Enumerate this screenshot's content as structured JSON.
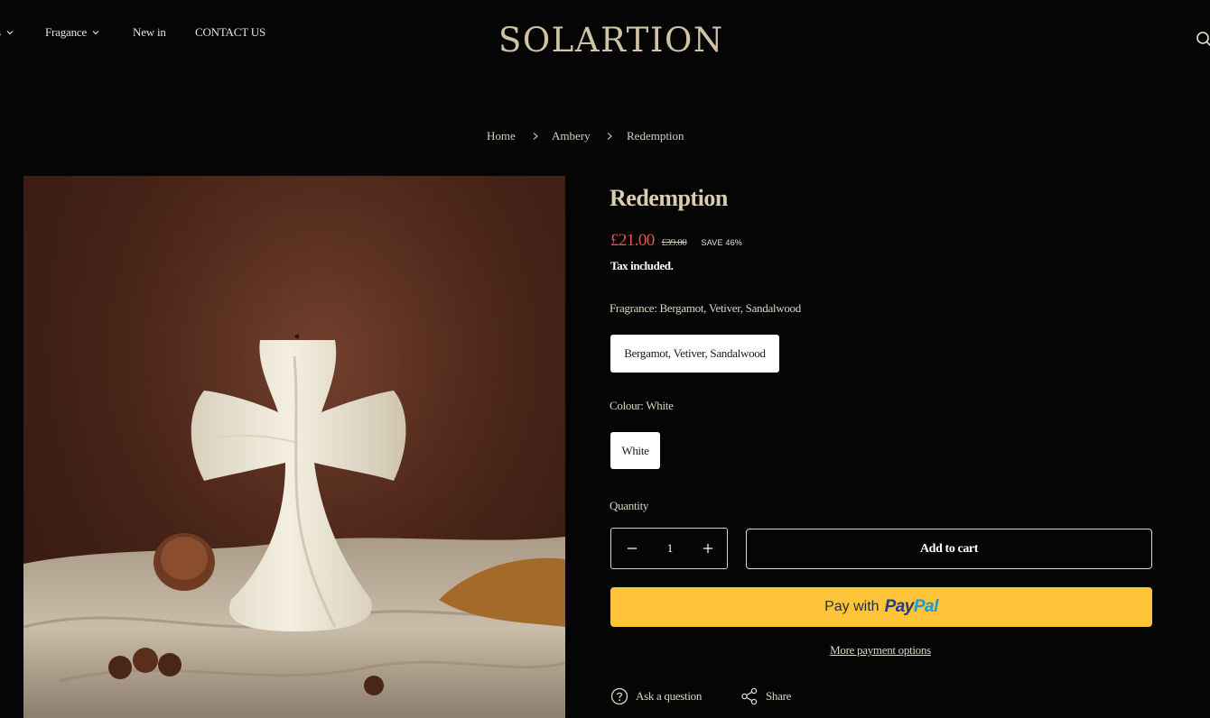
{
  "header": {
    "nav": [
      {
        "label": "s",
        "has_dropdown": true
      },
      {
        "label": "Fragance",
        "has_dropdown": true
      },
      {
        "label": "New in",
        "has_dropdown": false
      },
      {
        "label": "CONTACT US",
        "has_dropdown": false
      }
    ],
    "logo": "SOLARTION",
    "search_icon": "search-icon"
  },
  "breadcrumb": [
    "Home",
    "Ambery",
    "Redemption"
  ],
  "product": {
    "title": "Redemption",
    "price": "£21.00",
    "compare_price": "£39.00",
    "save_badge": "SAVE 46%",
    "tax_note": "Tax included.",
    "options": {
      "fragrance_label": "Fragrance: Bergamot, Vetiver, Sandalwood",
      "fragrance_value": "Bergamot, Vetiver, Sandalwood",
      "colour_label": "Colour: White",
      "colour_value": "White"
    },
    "quantity_label": "Quantity",
    "quantity": "1",
    "add_to_cart": "Add to cart",
    "paypal": {
      "prefix": "Pay with",
      "pay": "Pay",
      "pal": "Pal"
    },
    "more_payment": "More payment options",
    "ask_question": "Ask a question",
    "share": "Share"
  },
  "colors": {
    "background": "#050505",
    "sale_price": "#e4544a",
    "paypal_button": "#ffc439"
  }
}
